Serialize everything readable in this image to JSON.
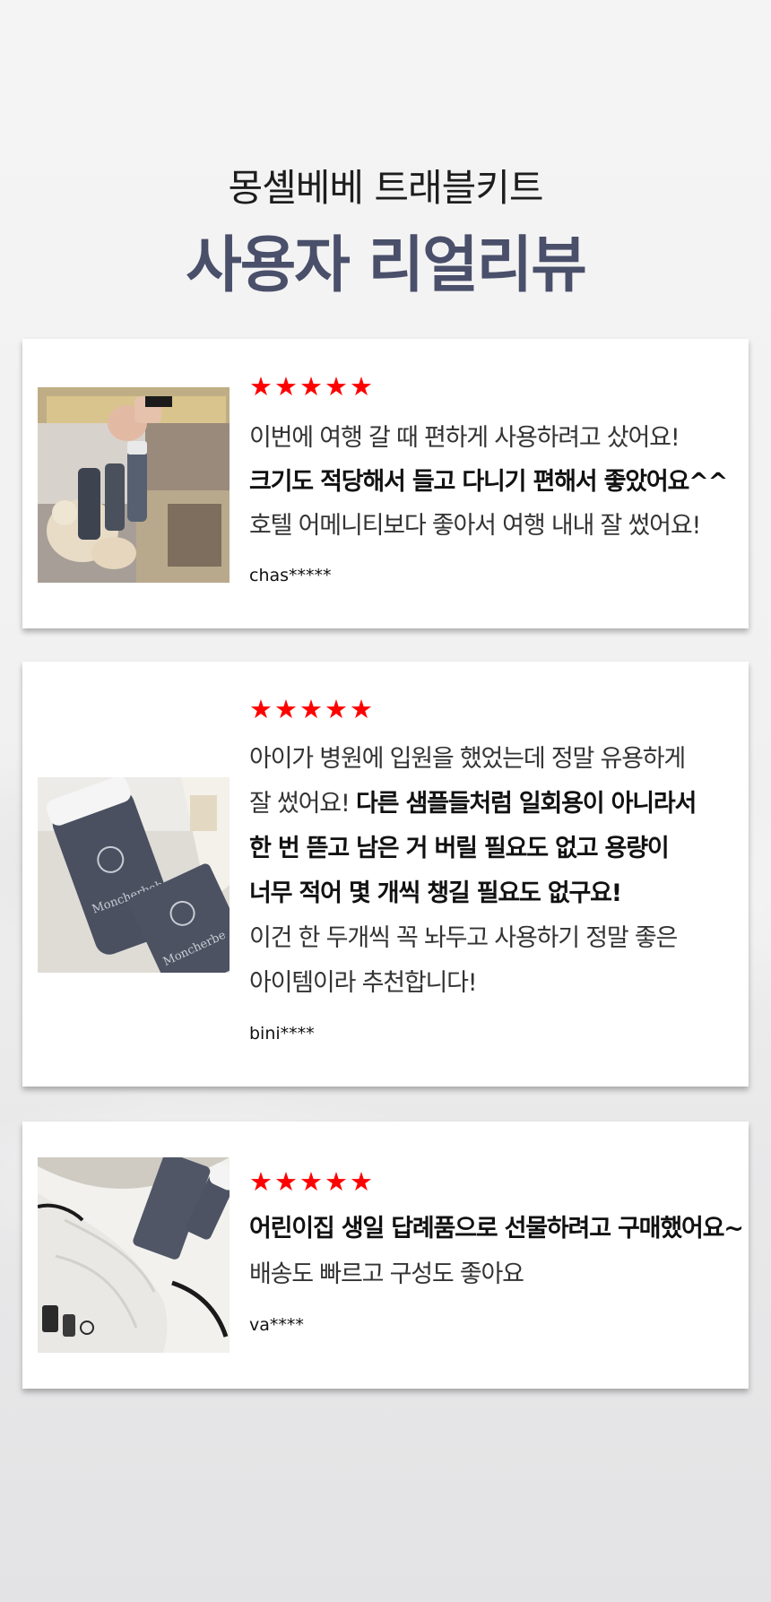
{
  "header": {
    "subtitle": "몽셸베베 트래블키트",
    "title": "사용자 리얼리뷰"
  },
  "colors": {
    "star": "#ff0000",
    "title": "#4a4f6a"
  },
  "reviews": [
    {
      "stars": "★★★★★",
      "rating": 5,
      "lines": [
        "이번에 여행 갈 때 편하게 사용하려고 샀어요!",
        "크기도 적당해서 들고 다니기 편해서 좋았어요^^",
        "호텔 어메니티보다 좋아서 여행 내내 잘 썼어요!"
      ],
      "reviewer": "chas*****"
    },
    {
      "stars": "★★★★★",
      "rating": 5,
      "lines": [
        "아이가 병원에 입원을 했었는데 정말 유용하게",
        "잘 썼어요!",
        "다른 샘플들처럼 일회용이 아니라서",
        "한 번 뜯고 남은 거 버릴 필요도 없고 용량이",
        "너무 적어 몇 개씩 챙길 필요도 없구요!",
        "이건 한 두개씩 꼭 놔두고 사용하기 정말 좋은",
        "아이템이라 추천합니다!"
      ],
      "reviewer": "bini****"
    },
    {
      "stars": "★★★★★",
      "rating": 5,
      "lines": [
        "어린이집 생일 답례품으로 선물하려고 구매했어요~",
        "배송도 빠르고 구성도 좋아요"
      ],
      "reviewer": "va****"
    }
  ]
}
